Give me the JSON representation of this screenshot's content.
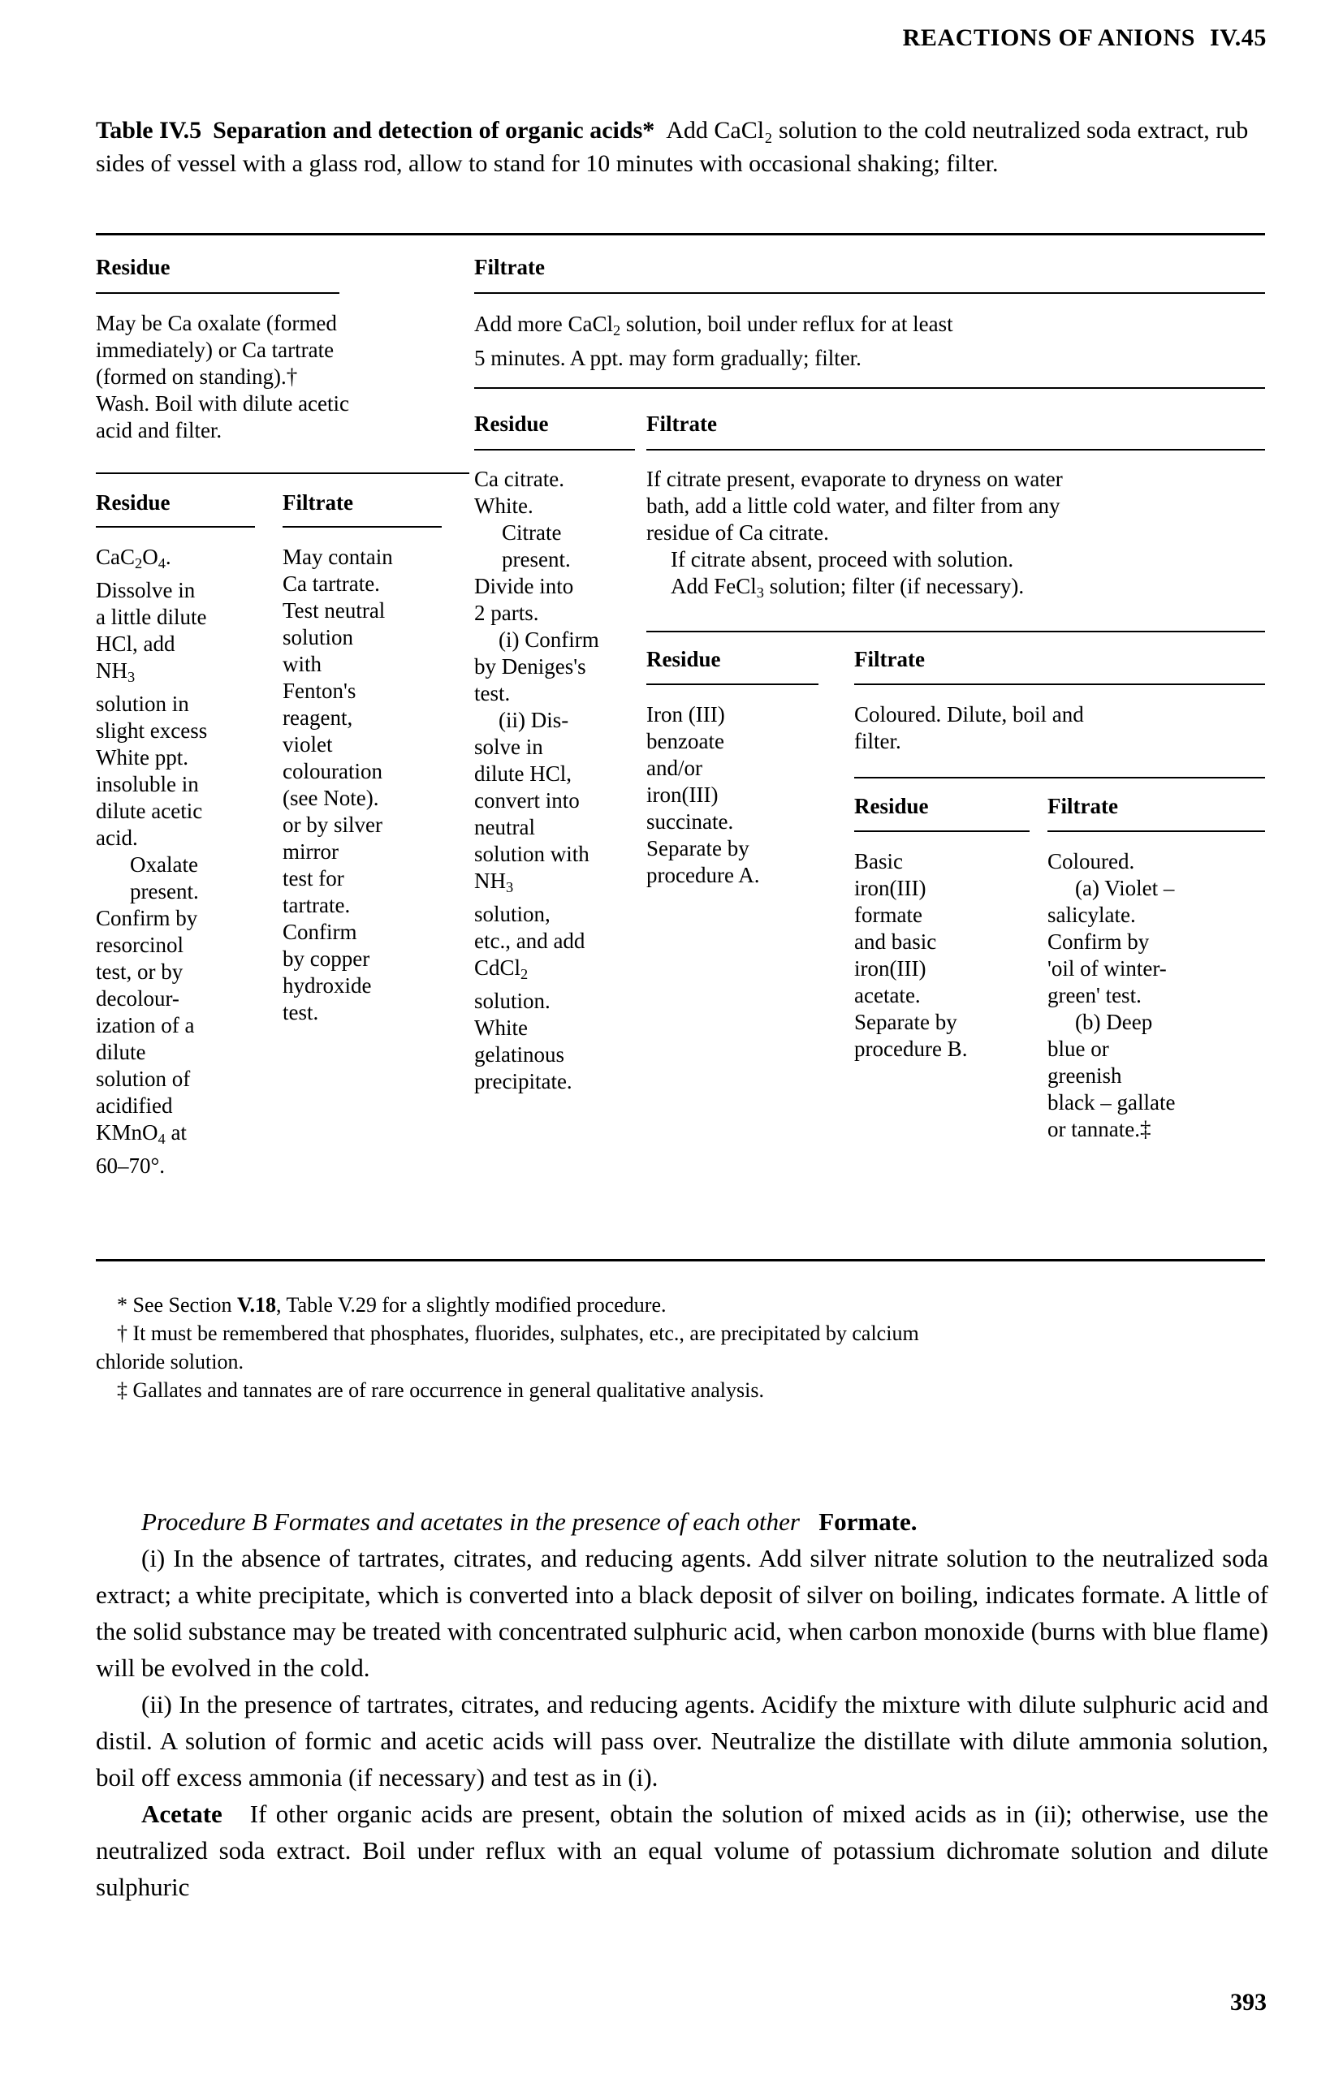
{
  "running_head": {
    "title": "REACTIONS OF ANIONS",
    "section": "IV.45"
  },
  "table": {
    "caption_label": "Table IV.5",
    "caption_title": "Separation and detection of organic acids*",
    "caption_text": "Add CaCl₂ solution to the cold neutralized soda extract, rub sides of vessel with a glass rod, allow to stand for 10 minutes with occasional shaking; filter.",
    "headers": {
      "residue": "Residue",
      "filtrate": "Filtrate"
    },
    "level1": {
      "residue_header": "Residue",
      "filtrate_header": "Filtrate",
      "residue_text": "May be Ca oxalate (formed\nimmediately) or Ca tartrate\n(formed on standing).†\nWash. Boil with dilute acetic\nacid and filter.",
      "filtrate_text": "Add more CaCl₂ solution, boil under reflux for at least\n5 minutes. A ppt. may form gradually; filter."
    },
    "level2_left": {
      "residue_header": "Residue",
      "filtrate_header": "Filtrate",
      "residue_text": "CaC₂O₄.\nDissolve in\na little dilute\nHCl, add\nNH₃\nsolution in\nslight excess\nWhite ppt.\ninsoluble in\ndilute acetic\nacid.\n    Oxalate\n    present.\nConfirm by\nresorcinol\ntest, or by\ndecolour-\nization of a\ndilute\nsolution of\nacidified\nKMnO₄ at\n60–70°.",
      "filtrate_text": "May contain\nCa tartrate.\nTest neutral\nsolution\nwith\nFenton's\nreagent,\nviolet\ncolouration\n(see Note).\nor by silver\nmirror\ntest for\ntartrate.\nConfirm\nby copper\nhydroxide\ntest."
    },
    "level2_right": {
      "residue_header": "Residue",
      "filtrate_header": "Filtrate",
      "residue_text": "Ca citrate.\nWhite.\n    Citrate\n    present.\nDivide into\n2 parts.\n    (i) Confirm\nby Deniges's\ntest.\n    (ii) Dis-\nsolve in\ndilute HCl,\nconvert into\nneutral\nsolution with\nNH₃\nsolution,\netc., and add\nCdCl₂\nsolution.\nWhite\ngelatinous\nprecipitate.",
      "filtrate_text": "If citrate present, evaporate to dryness on water\nbath, add a little cold water, and filter from any\nresidue of Ca citrate.\n    If citrate absent, proceed with solution.\n    Add FeCl₃ solution; filter (if necessary)."
    },
    "level3": {
      "residue_header": "Residue",
      "filtrate_header": "Filtrate",
      "residue_text": "Iron (III)\nbenzoate\nand/or\niron(III)\nsuccinate.\nSeparate by\nprocedure A.",
      "filtrate_text": "Coloured. Dilute, boil and\nfilter."
    },
    "level4": {
      "residue_header": "Residue",
      "filtrate_header": "Filtrate",
      "residue_text": "Basic\niron(III)\nformate\nand basic\niron(III)\nacetate.\nSeparate by\nprocedure B.",
      "filtrate_text": "Coloured.\n    (a) Violet –\nsalicylate.\nConfirm by\n'oil of winter-\ngreen' test.\n    (b) Deep\nblue or\ngreenish\nblack – gallate\nor tannate.‡"
    }
  },
  "footnotes": [
    "* See Section V.18, Table V.29 for a slightly modified procedure.",
    "† It must be remembered that phosphates, fluorides, sulphates, etc., are precipitated by calcium chloride solution.",
    "‡ Gallates and tannates are of rare occurrence in general qualitative analysis."
  ],
  "footnote_bold_runs": {
    "fn1_a": "V.18",
    "fn1_b": "V.29"
  },
  "body": {
    "procedure_heading_italic": "Procedure B   Formates and acetates in the presence of each other",
    "procedure_heading_bold": "Formate.",
    "paragraph_i": "(i) In the absence of tartrates, citrates, and reducing agents. Add silver nitrate solution to the neutralized soda extract; a white precipitate, which is converted into a black deposit of silver on boiling, indicates formate. A little of the solid substance may be treated with concentrated sulphuric acid, when carbon monoxide (burns with blue flame) will be evolved in the cold.",
    "paragraph_ii": "(ii) In the presence of tartrates, citrates, and reducing agents. Acidify the mixture with dilute sulphuric acid and distil. A solution of formic and acetic acids will pass over. Neutralize the distillate with dilute ammonia solution, boil off excess ammonia (if necessary) and test as in (i).",
    "acetate_label": "Acetate",
    "paragraph_acetate": "If other organic acids are present, obtain the solution of mixed acids as in (ii); otherwise, use the neutralized soda extract. Boil under reflux with an equal volume of potassium dichromate solution and dilute sulphuric"
  },
  "folio": "393"
}
